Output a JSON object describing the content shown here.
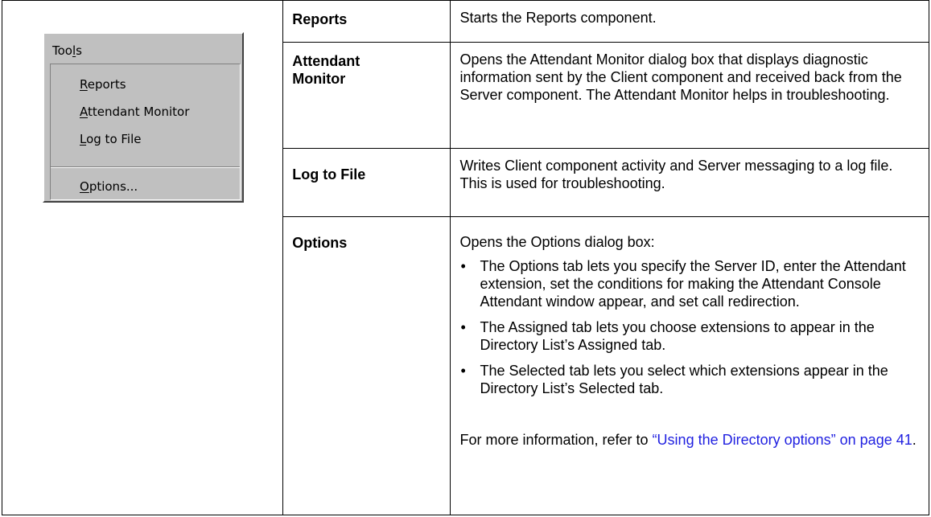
{
  "menu": {
    "title": [
      "Too",
      "l",
      "s"
    ],
    "items": [
      {
        "mn": "R",
        "rest": "eports"
      },
      {
        "mn": "A",
        "rest": "ttendant Monitor"
      },
      {
        "mn": "L",
        "rest": "og to File"
      },
      {
        "mn": "O",
        "rest": "ptions..."
      }
    ]
  },
  "rows": [
    {
      "term": "Reports",
      "desc": "Starts the Reports component."
    },
    {
      "term": "Attendant Monitor",
      "desc": "Opens the Attendant Monitor dialog box that displays diagnostic information sent by the Client component and received back from the Server component. The Attendant Monitor helps in troubleshooting."
    },
    {
      "term": "Log to File",
      "desc": "Writes Client component activity and Server messaging to a log file. This is used for troubleshooting."
    },
    {
      "term": "Options",
      "intro": "Opens the Options dialog box:",
      "bullets": [
        "The Options tab lets you specify the Server ID, enter the Attendant extension, set the conditions for making the Attendant Console Attendant window appear, and set call redirection.",
        "The Assigned tab lets you choose extensions to appear in the Directory List’s Assigned tab.",
        "The Selected tab lets you select which extensions appear in the Directory List’s Selected tab."
      ],
      "more_prefix": "For more information, refer to ",
      "link_text": "“Using the Directory options” on page 41",
      "more_suffix": "."
    }
  ]
}
